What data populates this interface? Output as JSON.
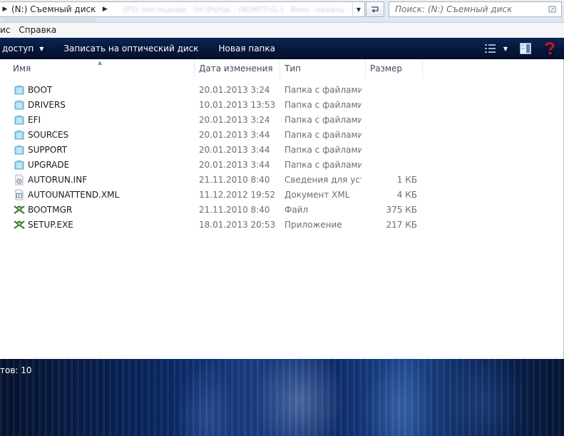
{
  "address_bar": {
    "path_prefix_arrow": "▶",
    "location": "(N:) Съемный диск",
    "location_arrow": "▶",
    "ghost_text": "(PS) последний · (H:)Portal · (Ni)MTF(G:) · Винс ·хайаль ·"
  },
  "search": {
    "placeholder": "Поиск: (N:) Съемный диск"
  },
  "menu": {
    "items": [
      "ис",
      "Справка"
    ]
  },
  "toolbar": {
    "share_label": "доступ",
    "burn_label": "Записать на оптический диск",
    "new_folder_label": "Новая папка"
  },
  "columns": {
    "name": "Имя",
    "date": "Дата изменения",
    "type": "Тип",
    "size": "Размер"
  },
  "files": [
    {
      "name": "BOOT",
      "date": "20.01.2013 3:24",
      "type": "Папка с файлами",
      "size": "",
      "icon": "folder-icon"
    },
    {
      "name": "DRIVERS",
      "date": "10.01.2013 13:53",
      "type": "Папка с файлами",
      "size": "",
      "icon": "folder-icon"
    },
    {
      "name": "EFI",
      "date": "20.01.2013 3:24",
      "type": "Папка с файлами",
      "size": "",
      "icon": "folder-icon"
    },
    {
      "name": "SOURCES",
      "date": "20.01.2013 3:44",
      "type": "Папка с файлами",
      "size": "",
      "icon": "folder-icon"
    },
    {
      "name": "SUPPORT",
      "date": "20.01.2013 3:44",
      "type": "Папка с файлами",
      "size": "",
      "icon": "folder-icon"
    },
    {
      "name": "UPGRADE",
      "date": "20.01.2013 3:44",
      "type": "Папка с файлами",
      "size": "",
      "icon": "folder-icon"
    },
    {
      "name": "AUTORUN.INF",
      "date": "21.11.2010 8:40",
      "type": "Сведения для уст...",
      "size": "1 КБ",
      "icon": "autorun-inf-icon"
    },
    {
      "name": "AUTOUNATTEND.XML",
      "date": "11.12.2012 19:52",
      "type": "Документ XML",
      "size": "4 КБ",
      "icon": "xml-document-icon"
    },
    {
      "name": "BOOTMGR",
      "date": "21.11.2010 8:40",
      "type": "Файл",
      "size": "375 КБ",
      "icon": "setup-executable-icon"
    },
    {
      "name": "SETUP.EXE",
      "date": "18.01.2013 20:53",
      "type": "Приложение",
      "size": "217 КБ",
      "icon": "setup-executable-icon"
    }
  ],
  "details": {
    "item_count": "тов: 10"
  },
  "colors": {
    "toolbar": "#0a1c45",
    "folder": "#7ec8e8",
    "help": "#c0121a"
  }
}
